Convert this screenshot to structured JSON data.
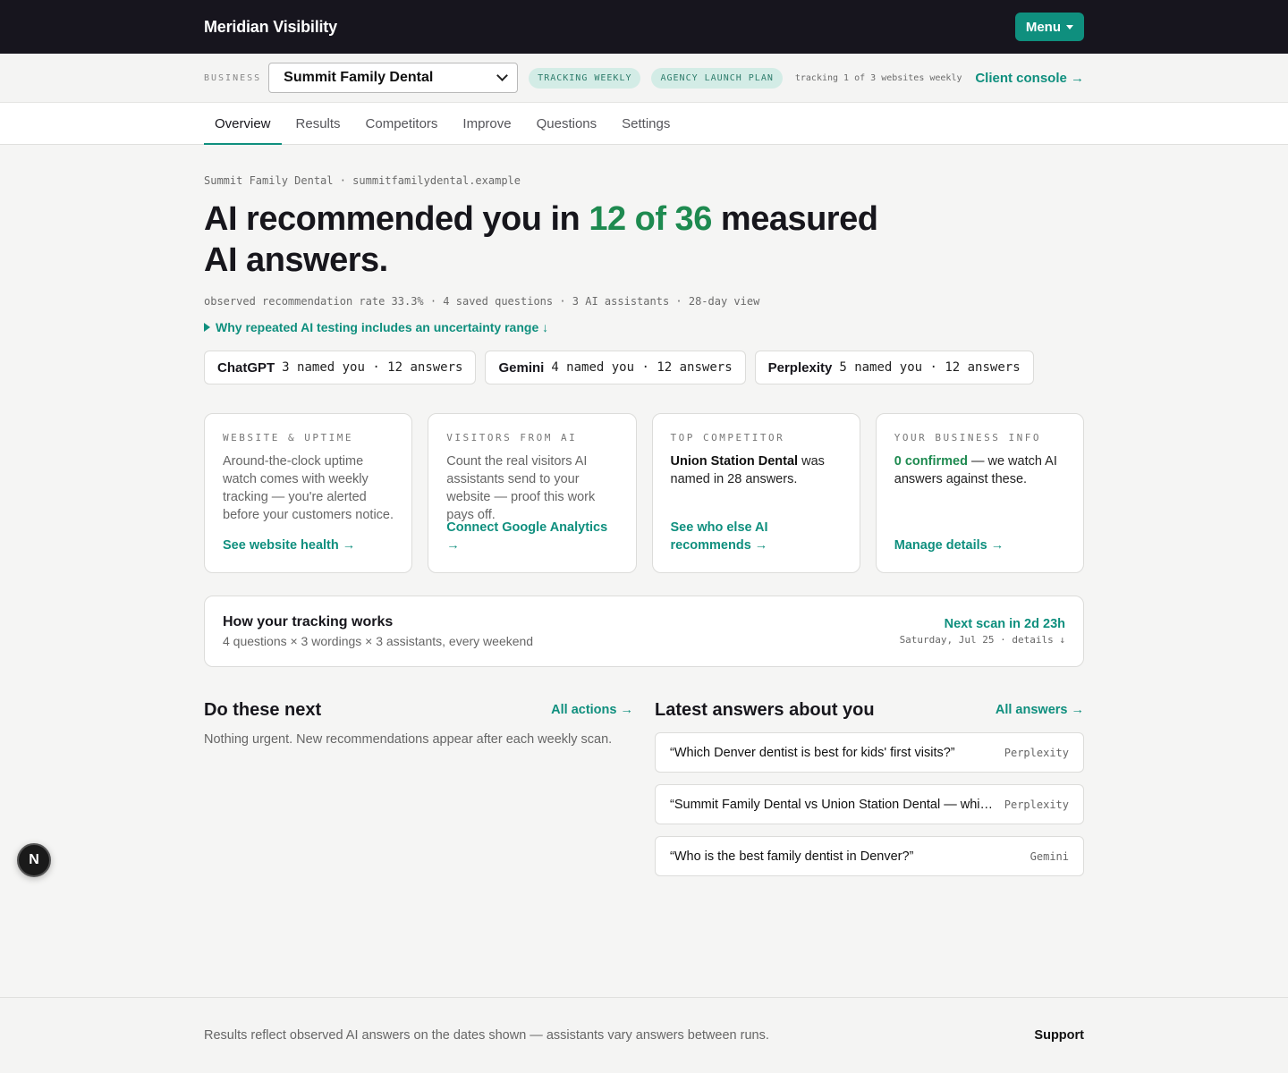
{
  "app": {
    "brand": "Meridian Visibility",
    "menu_label": "Menu"
  },
  "bizbar": {
    "label": "BUSINESS",
    "selected_business": "Summit Family Dental",
    "pill_tracking": "TRACKING WEEKLY",
    "pill_plan": "AGENCY LAUNCH PLAN",
    "tracking_note": "tracking 1 of 3 websites weekly",
    "client_console": "Client console →"
  },
  "tabs": [
    "Overview",
    "Results",
    "Competitors",
    "Improve",
    "Questions",
    "Settings"
  ],
  "overview": {
    "crumb": "Summit Family Dental · summitfamilydental.example",
    "headline_pre": "AI recommended you in ",
    "headline_highlight": "12 of 36",
    "headline_post": " measured AI answers.",
    "subline": "observed recommendation rate 33.3% · 4 saved questions · 3 AI assistants · 28-day view",
    "why_link": "Why repeated AI testing includes an uncertainty range ↓"
  },
  "assistants": [
    {
      "name": "ChatGPT",
      "stat": "3 named you · 12 answers"
    },
    {
      "name": "Gemini",
      "stat": "4 named you · 12 answers"
    },
    {
      "name": "Perplexity",
      "stat": "5 named you · 12 answers"
    }
  ],
  "cards": {
    "website": {
      "kicker": "WEBSITE & UPTIME",
      "text": "Around-the-clock uptime watch comes with weekly tracking — you're alerted before your customers notice.",
      "link": "See website health →"
    },
    "visitors": {
      "kicker": "VISITORS FROM AI",
      "text": "Count the real visitors AI assistants send to your website — proof this work pays off.",
      "link": "Connect Google Analytics →"
    },
    "competitor": {
      "kicker": "TOP COMPETITOR",
      "name": "Union Station Dental",
      "text_rest": " was named in 28 answers.",
      "link": "See who else AI recommends →"
    },
    "business_info": {
      "kicker": "YOUR BUSINESS INFO",
      "confirmed": "0 confirmed",
      "text_rest": " — we watch AI answers against these.",
      "link": "Manage details →"
    }
  },
  "how": {
    "title": "How your tracking works",
    "sub": "4 questions × 3 wordings × 3 assistants, every weekend",
    "next_scan": "Next scan in 2d 23h",
    "next_date": "Saturday, Jul 25 · details ↓"
  },
  "next_actions": {
    "title": "Do these next",
    "link": "All actions →",
    "empty": "Nothing urgent. New recommendations appear after each weekly scan."
  },
  "latest": {
    "title": "Latest answers about you",
    "link": "All answers →",
    "items": [
      {
        "question": "“Which Denver dentist is best for kids' first visits?”",
        "source": "Perplexity"
      },
      {
        "question": "“Summit Family Dental vs Union Station Dental — which is better for families?”",
        "source": "Perplexity"
      },
      {
        "question": "“Who is the best family dentist in Denver?”",
        "source": "Gemini"
      }
    ]
  },
  "badge": "N",
  "footer": {
    "note": "Results reflect observed AI answers on the dates shown — assistants vary answers between runs.",
    "support": "Support"
  },
  "colors": {
    "accent": "#0f8f7e",
    "positive": "#1e8a50",
    "topbar": "#17151e"
  }
}
